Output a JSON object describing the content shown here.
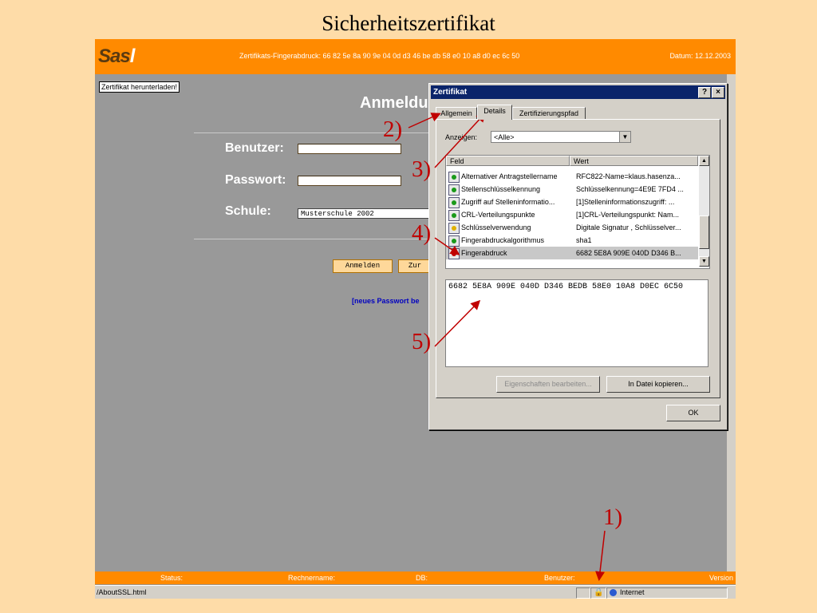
{
  "slide": {
    "title": "Sicherheitszertifikat"
  },
  "app": {
    "logo": {
      "part1": "Sas",
      "part2": "l"
    },
    "fingerprint_label": "Zertifikats-Fingerabdruck: 66 82 5e 8a 90 9e 04 0d d3 46 be db 58 e0 10 a8 d0 ec 6c 50",
    "date_label": "Datum: 12.12.2003",
    "download_button": "Zertifikat herunterladen!",
    "page_title": "Anmeldu",
    "form": {
      "benutzer_label": "Benutzer:",
      "passwort_label": "Passwort:",
      "schule_label": "Schule:",
      "schule_value": "Musterschule 2002"
    },
    "login_button": "Anmelden",
    "back_button": "Zur",
    "password_link": "[neues Passwort be"
  },
  "status_bar": {
    "status": "Status:",
    "rechnername": "Rechnername:",
    "db": "DB:",
    "benutzer": "Benutzer:",
    "version": "Version"
  },
  "browser_status": {
    "url": "/AboutSSL.html",
    "zone": "Internet"
  },
  "dialog": {
    "title": "Zertifikat",
    "help_btn": "?",
    "close_btn": "×",
    "tabs": [
      "Allgemein",
      "Details",
      "Zertifizierungspfad"
    ],
    "show_label": "Anzeigen:",
    "show_value": "<Alle>",
    "columns": {
      "field": "Feld",
      "value": "Wert"
    },
    "rows": [
      {
        "field": "Alternativer Antragstellername",
        "value": "RFC822-Name=klaus.hasenza..."
      },
      {
        "field": "Stellenschlüsselkennung",
        "value": "Schlüsselkennung=4E9E 7FD4 ..."
      },
      {
        "field": "Zugriff auf Stelleninformatio...",
        "value": "[1]Stelleninformationszugriff: ..."
      },
      {
        "field": "CRL-Verteilungspunkte",
        "value": "[1]CRL-Verteilungspunkt: Nam..."
      },
      {
        "field": "Schlüsselverwendung",
        "value": "Digitale Signatur , Schlüsselver..."
      },
      {
        "field": "Fingerabdruckalgorithmus",
        "value": "sha1"
      },
      {
        "field": "Fingerabdruck",
        "value": "6682 5E8A 909E 040D D346 B..."
      }
    ],
    "detail_text": "6682 5E8A 909E 040D D346 BEDB 58E0 10A8 D0EC 6C50",
    "edit_button": "Eigenschaften bearbeiten...",
    "copy_button": "In Datei kopieren...",
    "ok_button": "OK"
  },
  "annotations": [
    "1)",
    "2)",
    "3)",
    "4)",
    "5)"
  ],
  "colors": {
    "accent": "#ff8a00",
    "annotation": "#c00000",
    "slide_bg": "#fedca8",
    "dialog_title": "#0a246a"
  }
}
